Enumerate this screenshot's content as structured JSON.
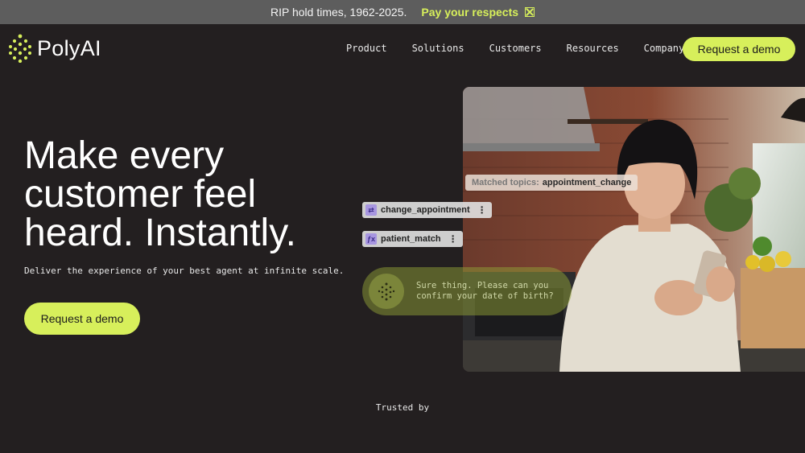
{
  "announcement": {
    "message": "RIP hold times, 1962-2025.",
    "link_label": "Pay your respects",
    "link_icon": "external-link-icon"
  },
  "header": {
    "brand": "PolyAI",
    "nav": [
      "Product",
      "Solutions",
      "Customers",
      "Resources",
      "Company"
    ],
    "cta_label": "Request a demo"
  },
  "hero": {
    "title_lines": [
      "Make every",
      "customer feel",
      "heard. Instantly."
    ],
    "subtitle": "Deliver the experience of your best agent at infinite scale.",
    "cta_label": "Request a demo"
  },
  "overlay": {
    "matched_label": "Matched topics:",
    "matched_value": "appointment_change",
    "chips": [
      {
        "label": "change_appointment",
        "icon": "flow-icon"
      },
      {
        "label": "patient_match",
        "icon": "function-icon"
      }
    ],
    "bubble_text": "Sure thing. Please can you confirm your date of birth?"
  },
  "trusted_label": "Trusted by",
  "colors": {
    "background": "#231f20",
    "accent": "#d7ef5b",
    "announcement_bg": "#5d5d5d"
  }
}
